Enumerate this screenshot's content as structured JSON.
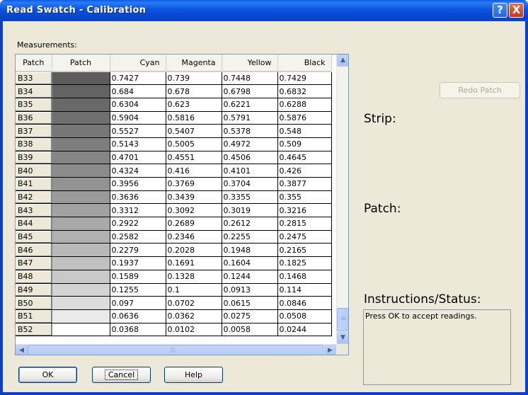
{
  "window": {
    "title": "Read Swatch - Calibration",
    "help_glyph": "?",
    "close_glyph": "X"
  },
  "measurements_label": "Measurements:",
  "table": {
    "headers": [
      "Patch",
      "Patch",
      "Cyan",
      "Magenta",
      "Yellow",
      "Black"
    ],
    "rows": [
      {
        "name": "B33",
        "color": "#5c5c5c",
        "cyan": "0.7427",
        "magenta": "0.739",
        "yellow": "0.7448",
        "black": "0.7429"
      },
      {
        "name": "B34",
        "color": "#636363",
        "cyan": "0.684",
        "magenta": "0.678",
        "yellow": "0.6798",
        "black": "0.6832"
      },
      {
        "name": "B35",
        "color": "#696969",
        "cyan": "0.6304",
        "magenta": "0.623",
        "yellow": "0.6221",
        "black": "0.6288"
      },
      {
        "name": "B36",
        "color": "#6f6f6f",
        "cyan": "0.5904",
        "magenta": "0.5816",
        "yellow": "0.5791",
        "black": "0.5876"
      },
      {
        "name": "B37",
        "color": "#777777",
        "cyan": "0.5527",
        "magenta": "0.5407",
        "yellow": "0.5378",
        "black": "0.548"
      },
      {
        "name": "B38",
        "color": "#7e7e7e",
        "cyan": "0.5143",
        "magenta": "0.5005",
        "yellow": "0.4972",
        "black": "0.509"
      },
      {
        "name": "B39",
        "color": "#858585",
        "cyan": "0.4701",
        "magenta": "0.4551",
        "yellow": "0.4506",
        "black": "0.4645"
      },
      {
        "name": "B40",
        "color": "#8c8c8c",
        "cyan": "0.4324",
        "magenta": "0.416",
        "yellow": "0.4101",
        "black": "0.426"
      },
      {
        "name": "B41",
        "color": "#939393",
        "cyan": "0.3956",
        "magenta": "0.3769",
        "yellow": "0.3704",
        "black": "0.3877"
      },
      {
        "name": "B42",
        "color": "#9a9a9a",
        "cyan": "0.3636",
        "magenta": "0.3439",
        "yellow": "0.3355",
        "black": "0.355"
      },
      {
        "name": "B43",
        "color": "#a2a2a2",
        "cyan": "0.3312",
        "magenta": "0.3092",
        "yellow": "0.3019",
        "black": "0.3216"
      },
      {
        "name": "B44",
        "color": "#a9a9a9",
        "cyan": "0.2922",
        "magenta": "0.2689",
        "yellow": "0.2612",
        "black": "0.2815"
      },
      {
        "name": "B45",
        "color": "#b1b1b1",
        "cyan": "0.2582",
        "magenta": "0.2346",
        "yellow": "0.2255",
        "black": "0.2475"
      },
      {
        "name": "B46",
        "color": "#b9b9b9",
        "cyan": "0.2279",
        "magenta": "0.2028",
        "yellow": "0.1948",
        "black": "0.2165"
      },
      {
        "name": "B47",
        "color": "#c1c1c1",
        "cyan": "0.1937",
        "magenta": "0.1691",
        "yellow": "0.1604",
        "black": "0.1825"
      },
      {
        "name": "B48",
        "color": "#c9c9c9",
        "cyan": "0.1589",
        "magenta": "0.1328",
        "yellow": "0.1244",
        "black": "0.1468"
      },
      {
        "name": "B49",
        "color": "#d3d3d3",
        "cyan": "0.1255",
        "magenta": "0.1",
        "yellow": "0.0913",
        "black": "0.114"
      },
      {
        "name": "B50",
        "color": "#dcdcdc",
        "cyan": "0.097",
        "magenta": "0.0702",
        "yellow": "0.0615",
        "black": "0.0846"
      },
      {
        "name": "B51",
        "color": "#eaeaea",
        "cyan": "0.0636",
        "magenta": "0.0362",
        "yellow": "0.0275",
        "black": "0.0508"
      },
      {
        "name": "B52",
        "color": "#ffffff",
        "cyan": "0.0368",
        "magenta": "0.0102",
        "yellow": "0.0058",
        "black": "0.0244"
      }
    ]
  },
  "scrollbars": {
    "up": "▲",
    "down": "▼",
    "left": "◀",
    "right": "▶",
    "grip": "≡",
    "hgrip": "|||"
  },
  "buttons": {
    "redo_patch": "Redo Patch",
    "ok": "OK",
    "cancel": "Cancel",
    "help": "Help"
  },
  "labels": {
    "strip": "Strip:",
    "patch": "Patch:",
    "instructions": "Instructions/Status:"
  },
  "status_text": "Press OK to accept readings.",
  "icons": {
    "help": "help-icon",
    "close": "close-icon"
  }
}
